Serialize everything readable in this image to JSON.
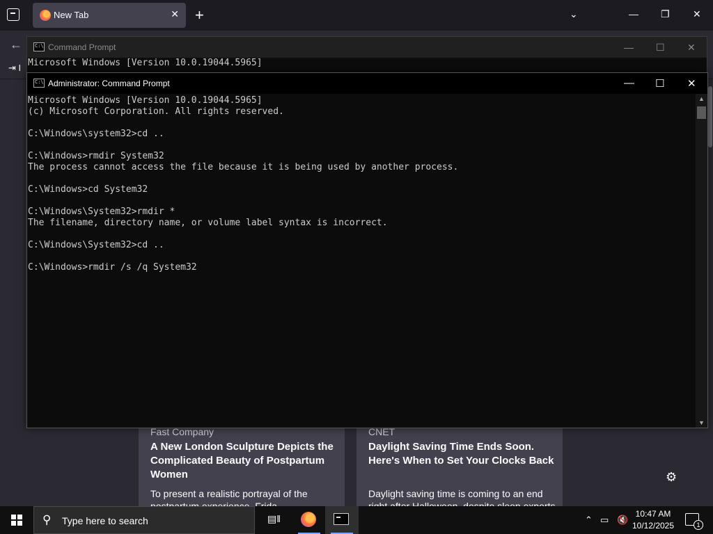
{
  "browser": {
    "tab_title": "New Tab",
    "tab_close": "✕",
    "new_tab": "+",
    "nav_partial_label": "I",
    "window_controls": {
      "minimize": "—",
      "maximize": "❐",
      "close": "✕"
    }
  },
  "cmd_background": {
    "title": "Command Prompt",
    "lines": [
      "Microsoft Windows [Version 10.0.19044.5965]"
    ]
  },
  "cmd_foreground": {
    "title": "Administrator: Command Prompt",
    "lines": [
      "Microsoft Windows [Version 10.0.19044.5965]",
      "(c) Microsoft Corporation. All rights reserved.",
      "",
      "C:\\Windows\\system32>cd ..",
      "",
      "C:\\Windows>rmdir System32",
      "The process cannot access the file because it is being used by another process.",
      "",
      "C:\\Windows>cd System32",
      "",
      "C:\\Windows\\System32>rmdir *",
      "The filename, directory name, or volume label syntax is incorrect.",
      "",
      "C:\\Windows\\System32>cd ..",
      "",
      "C:\\Windows>rmdir /s /q System32"
    ]
  },
  "news": [
    {
      "source": "Fast Company",
      "headline": "A New London Sculpture Depicts the Complicated Beauty of Postpartum Women",
      "description": "To present a realistic portrayal of the postpartum experience, Frida..."
    },
    {
      "source": "CNET",
      "headline": "Daylight Saving Time Ends Soon. Here's When to Set Your Clocks Back",
      "description": "Daylight saving time is coming to an end right after Halloween, despite sleep experts hoping to eliminate time changes..."
    }
  ],
  "taskbar": {
    "search_placeholder": "Type here to search",
    "time": "10:47 AM",
    "date": "10/12/2025",
    "notification_count": "1"
  },
  "icons": {
    "tab_list": "tab-list-icon",
    "back": "back-arrow-icon",
    "settings": "gear-icon",
    "start": "windows-logo-icon",
    "search": "search-icon",
    "task_view": "task-view-icon",
    "firefox": "firefox-icon",
    "cmd": "command-prompt-icon",
    "chevron_up": "chevron-up-icon",
    "network": "network-icon",
    "volume_muted": "volume-muted-icon",
    "notifications": "notification-center-icon"
  }
}
